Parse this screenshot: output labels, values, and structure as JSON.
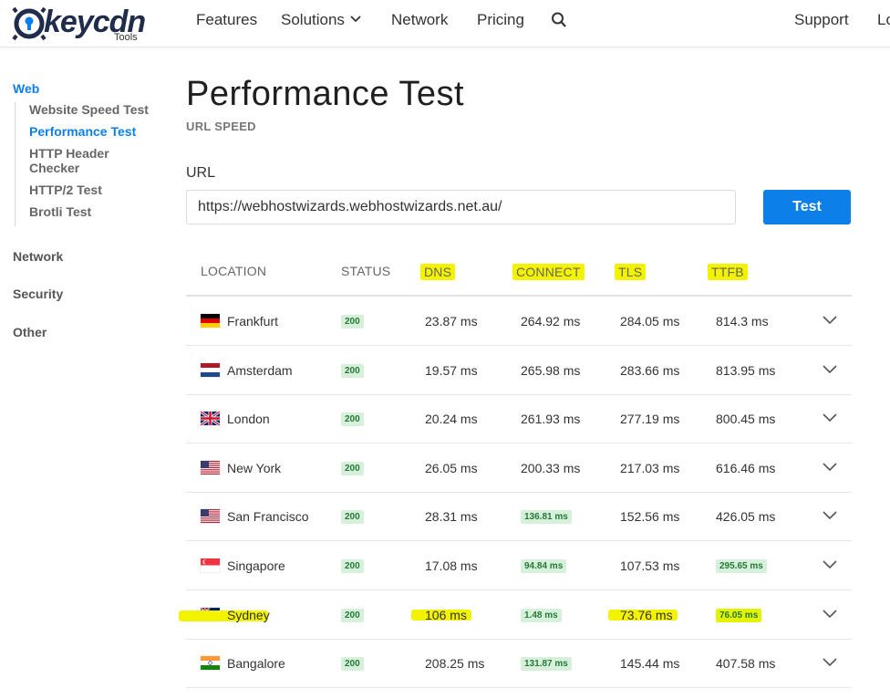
{
  "nav": {
    "logo_text": "keycdn",
    "logo_sub": "Tools",
    "items": [
      "Features",
      "Solutions",
      "Network",
      "Pricing"
    ],
    "support": "Support",
    "login": "Lo"
  },
  "sidebar": {
    "web": "Web",
    "web_links": [
      "Website Speed Test",
      "Performance Test",
      "HTTP Header Checker",
      "HTTP/2 Test",
      "Brotli Test"
    ],
    "active_link": "Performance Test",
    "network": "Network",
    "security": "Security",
    "other": "Other"
  },
  "main": {
    "title": "Performance Test",
    "subtitle": "URL SPEED",
    "url_label": "URL",
    "url_value": "https://webhostwizards.webhostwizards.net.au/",
    "test_button": "Test"
  },
  "table": {
    "headers": {
      "location": "LOCATION",
      "status": "STATUS",
      "dns": "DNS",
      "connect": "CONNECT",
      "tls": "TLS",
      "ttfb": "TTFB"
    },
    "rows": [
      {
        "location": "Frankfurt",
        "flag": "de",
        "status": "200",
        "dns": "23.87 ms",
        "connect": "264.92 ms",
        "tls": "284.05 ms",
        "ttfb": "814.3 ms",
        "connect_fast": false,
        "ttfb_fast": false
      },
      {
        "location": "Amsterdam",
        "flag": "nl",
        "status": "200",
        "dns": "19.57 ms",
        "connect": "265.98 ms",
        "tls": "283.66 ms",
        "ttfb": "813.95 ms",
        "connect_fast": false,
        "ttfb_fast": false
      },
      {
        "location": "London",
        "flag": "gb",
        "status": "200",
        "dns": "20.24 ms",
        "connect": "261.93 ms",
        "tls": "277.19 ms",
        "ttfb": "800.45 ms",
        "connect_fast": false,
        "ttfb_fast": false
      },
      {
        "location": "New York",
        "flag": "us",
        "status": "200",
        "dns": "26.05 ms",
        "connect": "200.33 ms",
        "tls": "217.03 ms",
        "ttfb": "616.46 ms",
        "connect_fast": false,
        "ttfb_fast": false
      },
      {
        "location": "San Francisco",
        "flag": "us",
        "status": "200",
        "dns": "28.31 ms",
        "connect": "136.81 ms",
        "tls": "152.56 ms",
        "ttfb": "426.05 ms",
        "connect_fast": true,
        "ttfb_fast": false
      },
      {
        "location": "Singapore",
        "flag": "sg",
        "status": "200",
        "dns": "17.08 ms",
        "connect": "94.84 ms",
        "tls": "107.53 ms",
        "ttfb": "295.65 ms",
        "connect_fast": true,
        "ttfb_fast": true
      },
      {
        "location": "Sydney",
        "flag": "au",
        "status": "200",
        "dns": "106 ms",
        "connect": "1.48 ms",
        "tls": "73.76 ms",
        "ttfb": "76.05 ms",
        "connect_fast": true,
        "ttfb_fast": true
      },
      {
        "location": "Bangalore",
        "flag": "in",
        "status": "200",
        "dns": "208.25 ms",
        "connect": "131.87 ms",
        "tls": "145.44 ms",
        "ttfb": "407.58 ms",
        "connect_fast": true,
        "ttfb_fast": false
      }
    ]
  },
  "colors": {
    "accent": "#0d7fe8",
    "highlight": "#f3f300",
    "badge_bg": "#d7f0dc",
    "badge_fg": "#247a34"
  }
}
